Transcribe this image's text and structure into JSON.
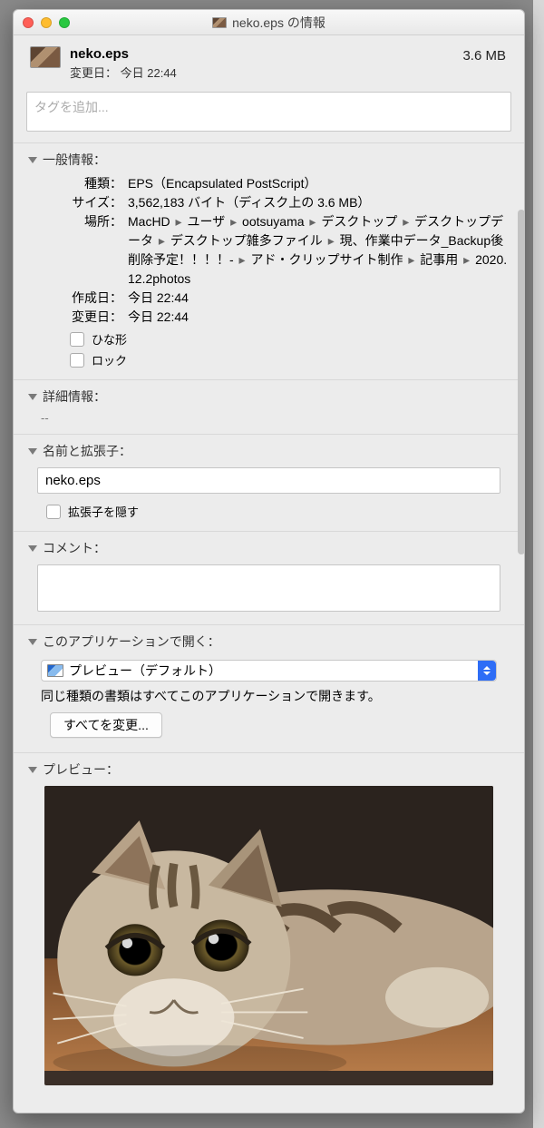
{
  "titlebar": {
    "title": "neko.eps の情報"
  },
  "header": {
    "filename": "neko.eps",
    "modified_label": "変更日：",
    "modified_value": "今日 22:44",
    "size": "3.6 MB"
  },
  "tags": {
    "placeholder": "タグを追加..."
  },
  "sections": {
    "general": {
      "title": "一般情報：",
      "kind_label": "種類：",
      "kind_value": "EPS（Encapsulated PostScript）",
      "size_label": "サイズ：",
      "size_value": "3,562,183 バイト（ディスク上の 3.6 MB）",
      "where_label": "場所：",
      "where_path": [
        "MacHD",
        "ユーザ",
        "ootsuyama",
        "デスクトップ",
        "デスクトップデータ",
        "デスクトップ雑多ファイル",
        "現、作業中データ_Backup後削除予定！！！！-",
        "アド・クリップサイト制作",
        "記事用",
        "2020.12.2photos"
      ],
      "created_label": "作成日：",
      "created_value": "今日 22:44",
      "modified_label": "変更日：",
      "modified_value": "今日 22:44",
      "stationery_label": "ひな形",
      "locked_label": "ロック"
    },
    "more": {
      "title": "詳細情報：",
      "dash": "--"
    },
    "name_ext": {
      "title": "名前と拡張子：",
      "value": "neko.eps",
      "hide_ext_label": "拡張子を隠す"
    },
    "comments": {
      "title": "コメント："
    },
    "open_with": {
      "title": "このアプリケーションで開く：",
      "app": "プレビュー（デフォルト）",
      "note": "同じ種類の書類はすべてこのアプリケーションで開きます。",
      "change_all": "すべてを変更..."
    },
    "preview": {
      "title": "プレビュー："
    }
  }
}
